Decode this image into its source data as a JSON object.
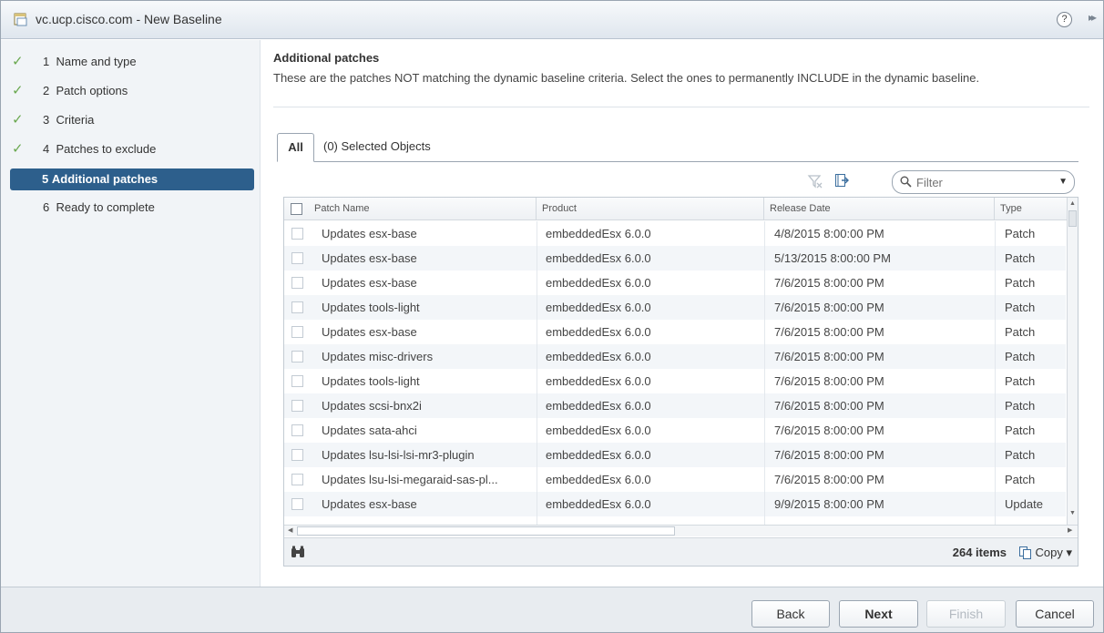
{
  "window": {
    "title": "vc.ucp.cisco.com - New Baseline",
    "app_icon": "document-window-icon",
    "help_label": "?",
    "expand_label": "▸▸"
  },
  "wizard": {
    "steps": [
      {
        "number": "1",
        "label": "Name and type",
        "completed": true,
        "active": false
      },
      {
        "number": "2",
        "label": "Patch options",
        "completed": true,
        "active": false
      },
      {
        "number": "3",
        "label": "Criteria",
        "completed": true,
        "active": false
      },
      {
        "number": "4",
        "label": "Patches to exclude",
        "completed": true,
        "active": false
      },
      {
        "number": "5",
        "label": "Additional patches",
        "completed": false,
        "active": true
      },
      {
        "number": "6",
        "label": "Ready to complete",
        "completed": false,
        "active": false
      }
    ],
    "check_glyph": "✓"
  },
  "main": {
    "title": "Additional patches",
    "description": "These are the patches NOT matching the dynamic baseline criteria. Select the ones to permanently INCLUDE in the dynamic baseline.",
    "tabs": [
      {
        "label": "All",
        "active": true
      },
      {
        "label": "(0) Selected Objects",
        "active": false
      }
    ],
    "filter_placeholder": "Filter"
  },
  "grid": {
    "columns": [
      "Patch Name",
      "Product",
      "Release Date",
      "Type"
    ],
    "rows": [
      {
        "name": "Updates esx-base",
        "product": "embeddedEsx 6.0.0",
        "date": "4/8/2015 8:00:00 PM",
        "type": "Patch"
      },
      {
        "name": "Updates esx-base",
        "product": "embeddedEsx 6.0.0",
        "date": "5/13/2015 8:00:00 PM",
        "type": "Patch"
      },
      {
        "name": "Updates esx-base",
        "product": "embeddedEsx 6.0.0",
        "date": "7/6/2015 8:00:00 PM",
        "type": "Patch"
      },
      {
        "name": "Updates tools-light",
        "product": "embeddedEsx 6.0.0",
        "date": "7/6/2015 8:00:00 PM",
        "type": "Patch"
      },
      {
        "name": "Updates esx-base",
        "product": "embeddedEsx 6.0.0",
        "date": "7/6/2015 8:00:00 PM",
        "type": "Patch"
      },
      {
        "name": "Updates misc-drivers",
        "product": "embeddedEsx 6.0.0",
        "date": "7/6/2015 8:00:00 PM",
        "type": "Patch"
      },
      {
        "name": "Updates tools-light",
        "product": "embeddedEsx 6.0.0",
        "date": "7/6/2015 8:00:00 PM",
        "type": "Patch"
      },
      {
        "name": "Updates scsi-bnx2i",
        "product": "embeddedEsx 6.0.0",
        "date": "7/6/2015 8:00:00 PM",
        "type": "Patch"
      },
      {
        "name": "Updates sata-ahci",
        "product": "embeddedEsx 6.0.0",
        "date": "7/6/2015 8:00:00 PM",
        "type": "Patch"
      },
      {
        "name": "Updates lsu-lsi-lsi-mr3-plugin",
        "product": "embeddedEsx 6.0.0",
        "date": "7/6/2015 8:00:00 PM",
        "type": "Patch"
      },
      {
        "name": "Updates lsu-lsi-megaraid-sas-pl...",
        "product": "embeddedEsx 6.0.0",
        "date": "7/6/2015 8:00:00 PM",
        "type": "Patch"
      },
      {
        "name": "Updates esx-base",
        "product": "embeddedEsx 6.0.0",
        "date": "9/9/2015 8:00:00 PM",
        "type": "Update"
      }
    ],
    "item_count": "264 items",
    "copy_label": "Copy ▾"
  },
  "footer": {
    "back_label": "Back",
    "next_label": "Next",
    "finish_label": "Finish",
    "cancel_label": "Cancel"
  },
  "colors": {
    "active_step": "#2d5f8c",
    "check": "#6aa84f"
  }
}
